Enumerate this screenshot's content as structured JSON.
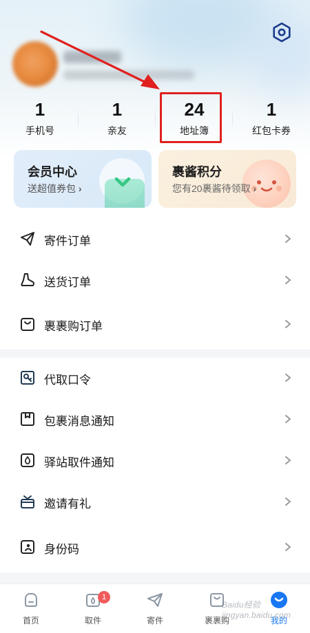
{
  "stats": [
    {
      "value": "1",
      "label": "手机号"
    },
    {
      "value": "1",
      "label": "亲友"
    },
    {
      "value": "24",
      "label": "地址簿"
    },
    {
      "value": "1",
      "label": "红包卡券"
    }
  ],
  "cards": {
    "vip": {
      "title": "会员中心",
      "subtitle": "送超值券包",
      "chevron": "›"
    },
    "points": {
      "title": "裹酱积分",
      "subtitle": "您有20裹酱待领取",
      "chevron": "›"
    }
  },
  "menu_group1": [
    {
      "label": "寄件订单",
      "icon": "send-plane-icon"
    },
    {
      "label": "送货订单",
      "icon": "boot-icon"
    },
    {
      "label": "裹裹购订单",
      "icon": "shopping-bag-icon"
    }
  ],
  "menu_group2": [
    {
      "label": "代取口令",
      "icon": "key-icon"
    },
    {
      "label": "包裹消息通知",
      "icon": "package-notice-icon"
    },
    {
      "label": "驿站取件通知",
      "icon": "drop-notice-icon"
    },
    {
      "label": "邀请有礼",
      "icon": "gift-icon"
    },
    {
      "label": "身份码",
      "icon": "id-code-icon"
    }
  ],
  "tabbar": [
    {
      "label": "首页",
      "icon": "home-icon"
    },
    {
      "label": "取件",
      "icon": "pickup-icon",
      "badge": "1"
    },
    {
      "label": "寄件",
      "icon": "send-icon"
    },
    {
      "label": "裹裹购",
      "icon": "bag-icon"
    },
    {
      "label": "我的",
      "icon": "me-icon",
      "active": true
    }
  ],
  "watermark": "Baidu经验 jingyan.baidu.com",
  "colors": {
    "accent": "#1877f2",
    "highlight_red": "#e0201e",
    "badge_red": "#f15b5b",
    "settings_blue": "#1b3b8c"
  }
}
